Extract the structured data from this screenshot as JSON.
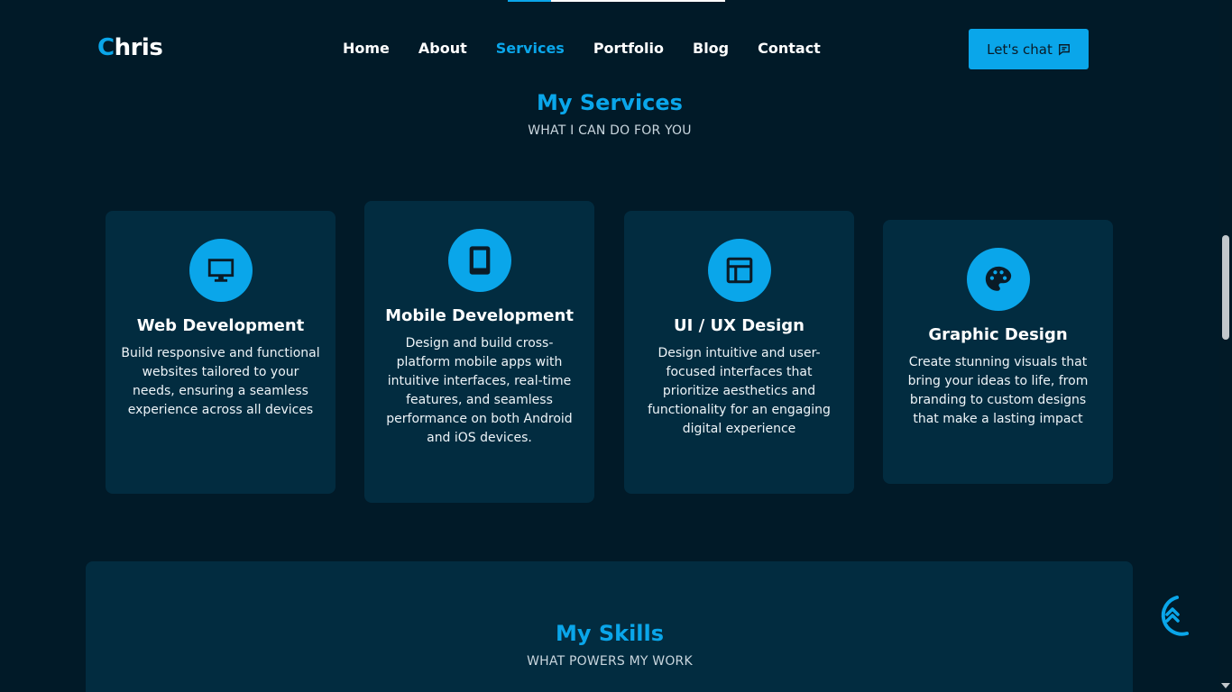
{
  "header": {
    "logo_first": "C",
    "logo_rest": "hris",
    "nav": [
      "Home",
      "About",
      "Services",
      "Portfolio",
      "Blog",
      "Contact"
    ],
    "active_nav": "Services",
    "chat_label": "Let's chat"
  },
  "services": {
    "title": "My Services",
    "subtitle": "WHAT I CAN DO FOR YOU",
    "cards": [
      {
        "icon": "monitor-icon",
        "title": "Web Development",
        "text": "Build responsive and functional websites tailored to your needs, ensuring a seamless experience across all devices"
      },
      {
        "icon": "tablet-icon",
        "title": "Mobile Development",
        "text": "Design and build cross-platform mobile apps with intuitive interfaces, real-time features, and seamless performance on both Android and iOS devices."
      },
      {
        "icon": "layout-icon",
        "title": "UI / UX Design",
        "text": "Design intuitive and user-focused interfaces that prioritize aesthetics and functionality for an engaging digital experience"
      },
      {
        "icon": "palette-icon",
        "title": "Graphic Design",
        "text": "Create stunning visuals that bring your ideas to life, from branding to custom designs that make a lasting impact"
      }
    ]
  },
  "skills": {
    "title": "My Skills",
    "subtitle": "WHAT POWERS MY WORK"
  },
  "colors": {
    "accent": "#0aa6ea",
    "background": "#011a28",
    "card": "#022c40"
  },
  "scroll_progress": 0.2
}
